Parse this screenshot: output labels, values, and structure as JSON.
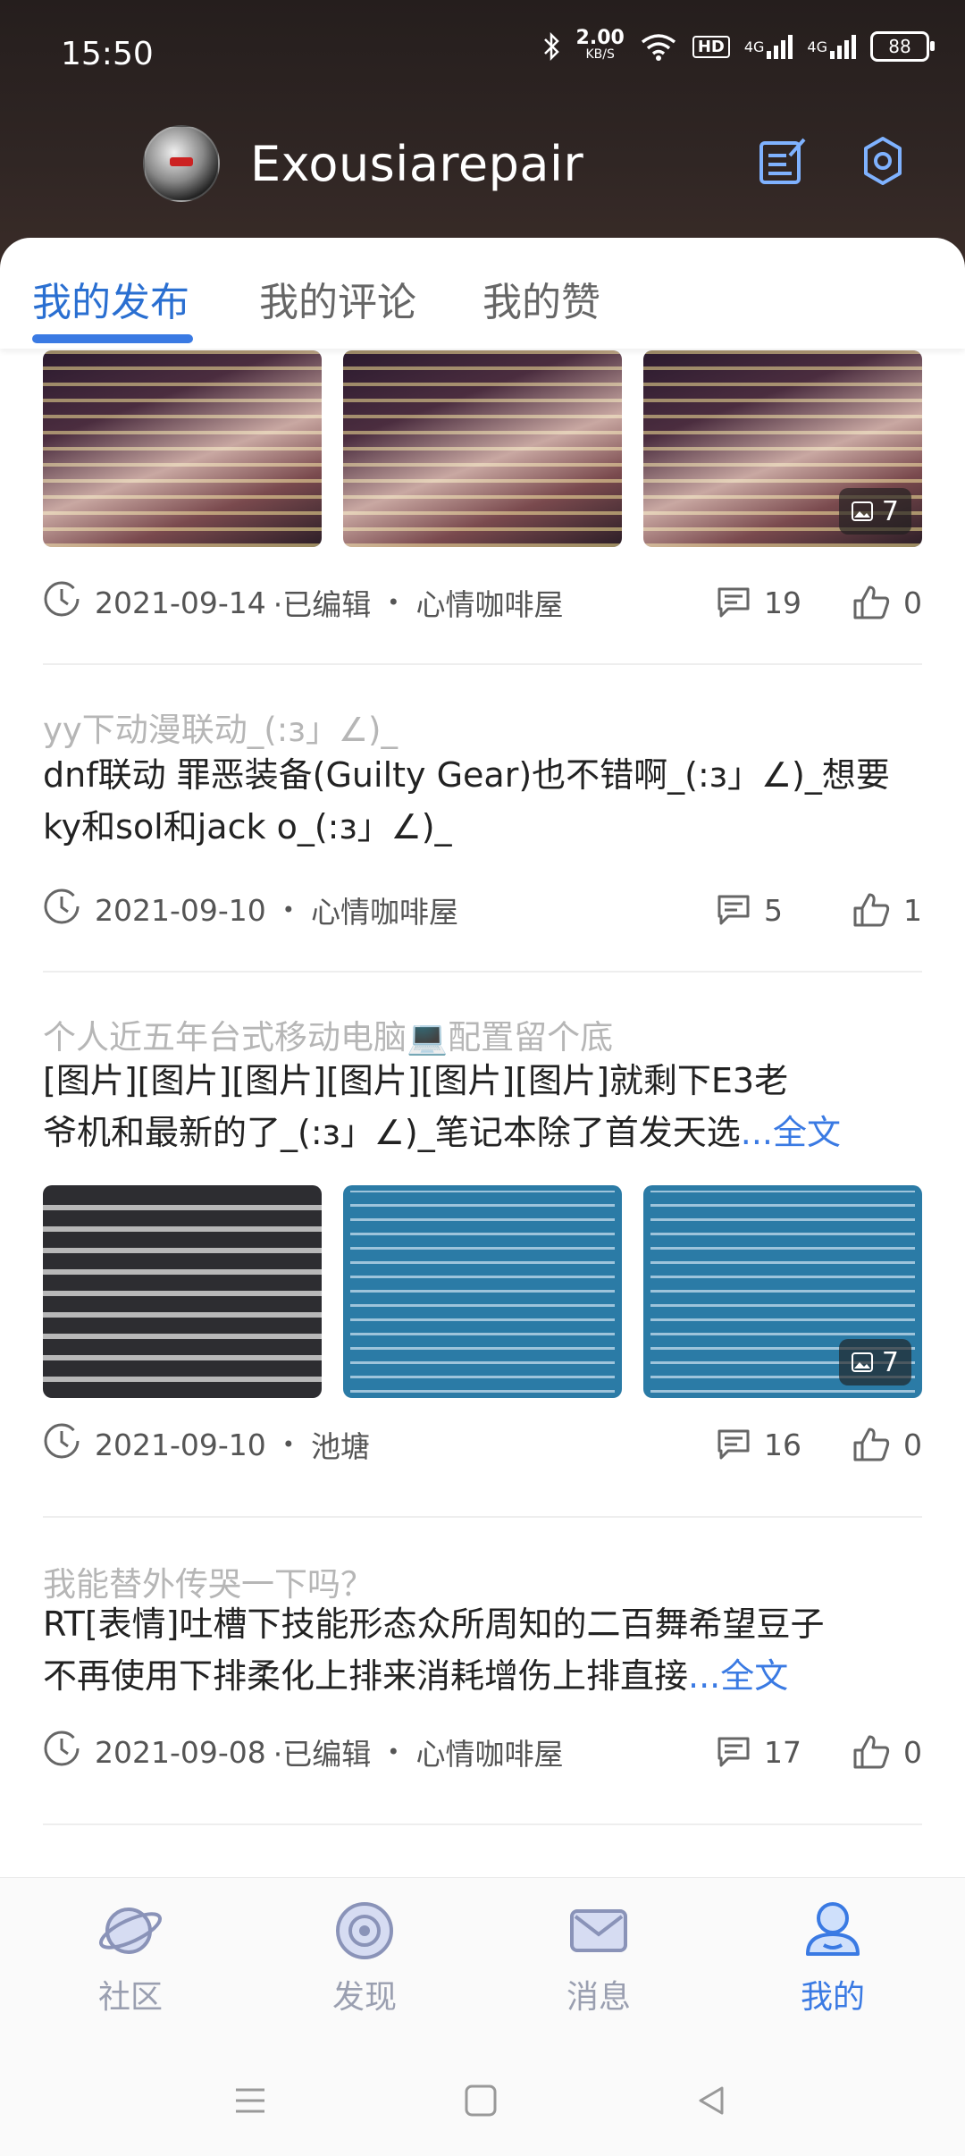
{
  "status_bar": {
    "time": "15:50",
    "speed_value": "2.00",
    "speed_unit": "KB/S",
    "hd_label": "HD",
    "net1": "4G",
    "net2": "4G",
    "battery": "88"
  },
  "header": {
    "username": "Exousiarepair",
    "edit_icon": "edit-note-icon",
    "settings_icon": "gear-icon"
  },
  "tabs": [
    {
      "label": "我的发布",
      "active": true
    },
    {
      "label": "我的评论",
      "active": false
    },
    {
      "label": "我的赞",
      "active": false
    }
  ],
  "posts": [
    {
      "title": "",
      "body": "",
      "more": "",
      "image_count": "7",
      "date": "2021-09-14",
      "edited": "·已编辑",
      "forum": "心情咖啡屋",
      "comments": "19",
      "likes": "0"
    },
    {
      "title": "yy下动漫联动_(:з」∠)_",
      "body_line1": "dnf联动 罪恶装备(Guilty Gear)也不错啊_(:з」∠)_想要",
      "body_line2": "ky和sol和jack o_(:з」∠)_",
      "date": "2021-09-10",
      "forum": "心情咖啡屋",
      "comments": "5",
      "likes": "1"
    },
    {
      "title": "个人近五年台式移动电脑💻配置留个底",
      "body_line1": "[图片][图片][图片][图片][图片][图片]就剩下E3老",
      "body_line2": "爷机和最新的了_(:з」∠)_笔记本除了首发天选",
      "more": "...全文",
      "image_count": "7",
      "date": "2021-09-10",
      "forum": "池塘",
      "comments": "16",
      "likes": "0"
    },
    {
      "title": "我能替外传哭一下吗？",
      "body_line1": " RT[表情]吐槽下技能形态众所周知的二百舞希望豆子",
      "body_line2": "不再使用下排柔化上排来消耗增伤上排直接",
      "more": "...全文",
      "date": "2021-09-08",
      "edited": "·已编辑",
      "forum": "心情咖啡屋",
      "comments": "17",
      "likes": "0"
    }
  ],
  "dot": "•",
  "bottom_nav": [
    {
      "label": "社区",
      "icon": "planet-icon"
    },
    {
      "label": "发现",
      "icon": "discover-icon"
    },
    {
      "label": "消息",
      "icon": "mail-icon"
    },
    {
      "label": "我的",
      "icon": "profile-icon",
      "active": true
    }
  ],
  "colors": {
    "accent": "#3a7ae3",
    "header_bg": "#2b2220",
    "muted": "#b6b6b6"
  }
}
